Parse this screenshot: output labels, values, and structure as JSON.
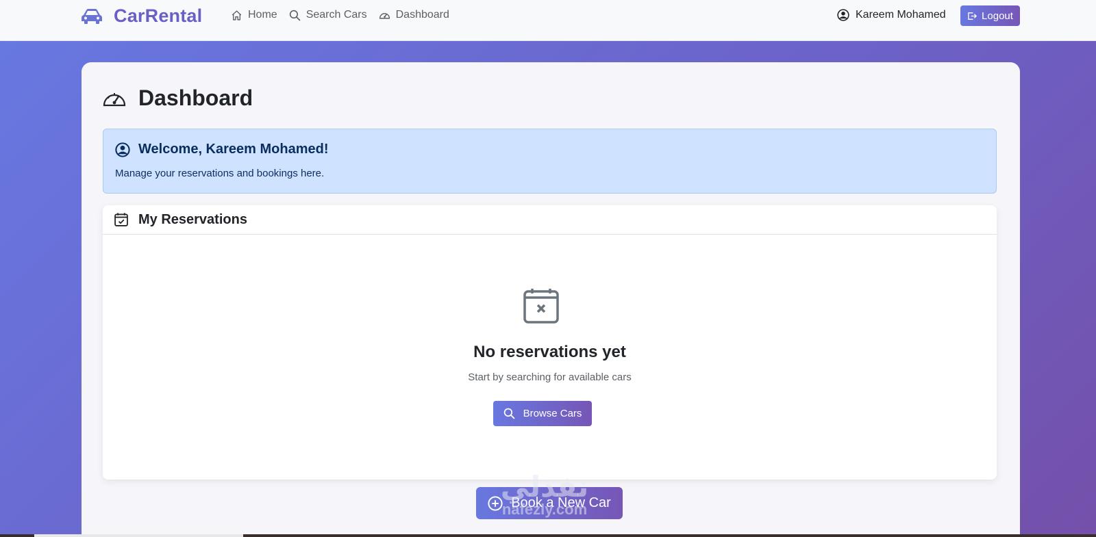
{
  "navbar": {
    "brand": "CarRental",
    "links": [
      {
        "label": "Home",
        "icon": "house-icon"
      },
      {
        "label": "Search Cars",
        "icon": "search-icon"
      },
      {
        "label": "Dashboard",
        "icon": "speedometer-icon"
      }
    ],
    "user_name": "Kareem Mohamed",
    "logout_label": "Logout"
  },
  "page": {
    "title": "Dashboard"
  },
  "welcome": {
    "title": "Welcome, Kareem Mohamed!",
    "subtitle": "Manage your reservations and bookings here."
  },
  "reservations": {
    "header": "My Reservations",
    "empty_title": "No reservations yet",
    "empty_subtitle": "Start by searching for available cars",
    "browse_label": "Browse Cars"
  },
  "book_button": {
    "label": "Book a New Car"
  },
  "watermark": {
    "arabic": "نفذلي",
    "latin": "nafezly.com"
  },
  "colors": {
    "brand": "#6a5fc4",
    "gradient_start": "#6779e2",
    "gradient_end": "#7450aa",
    "alert_bg": "#cfe2ff",
    "alert_text": "#0a2d5f"
  }
}
